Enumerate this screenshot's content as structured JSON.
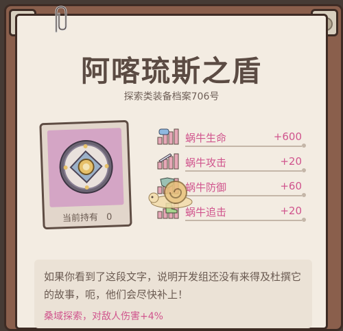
{
  "title": "阿喀琉斯之盾",
  "subtitle": "探索类装备档案706号",
  "card": {
    "owned_label": "当前持有",
    "owned_count": "0"
  },
  "stats": [
    {
      "icon": "heart-bars-icon",
      "label": "蜗牛生命",
      "value": "+600"
    },
    {
      "icon": "sword-bars-icon",
      "label": "蜗牛攻击",
      "value": "+20"
    },
    {
      "icon": "shield-bars-icon",
      "label": "蜗牛防御",
      "value": "+60"
    },
    {
      "icon": "boot-bars-icon",
      "label": "蜗牛追击",
      "value": "+20"
    }
  ],
  "description": "如果你看到了这段文字，说明开发组还没有来得及杜撰它的故事，呃，他们会尽快补上！",
  "bonus_text": "桑域探索，对敌人伤害+4%",
  "colors": {
    "accent": "#d0548d",
    "text": "#5b4b43",
    "card": "#d4a5c5"
  }
}
